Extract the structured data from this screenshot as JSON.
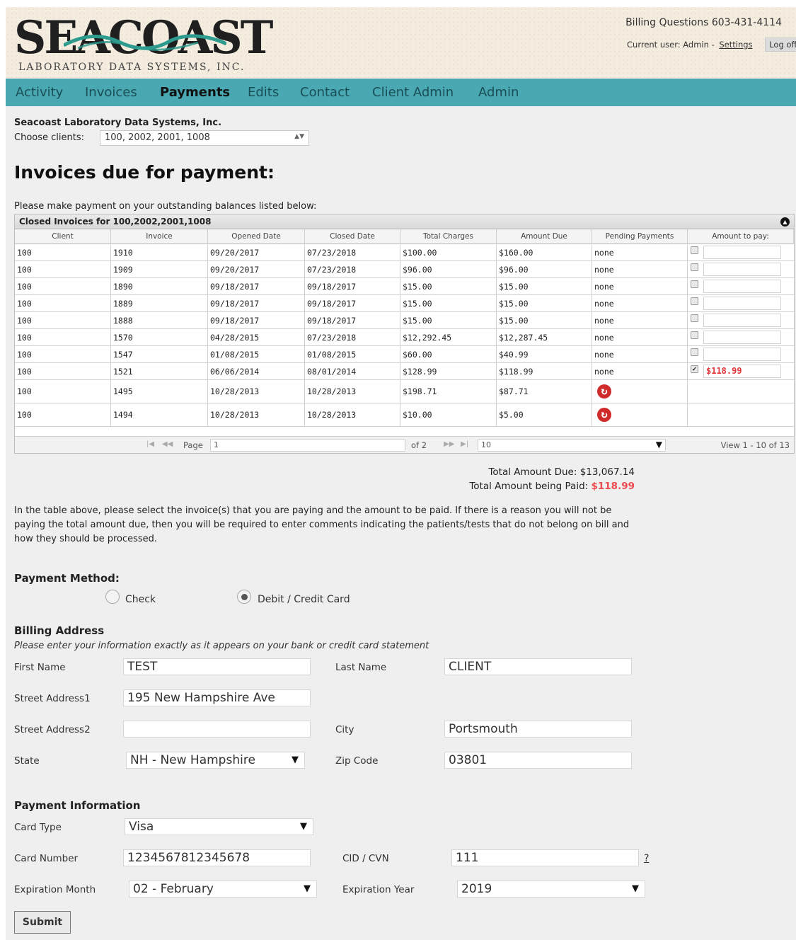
{
  "header": {
    "logo_main": "SEACOAST",
    "logo_sub": "LABORATORY DATA SYSTEMS, INC.",
    "billing_questions": "Billing Questions 603-431-4114",
    "current_user": "Current user: Admin -",
    "settings_label": "Settings",
    "logoff_label": "Log off"
  },
  "nav": [
    "Activity",
    "Invoices",
    "Payments",
    "Edits",
    "Contact",
    "Client Admin",
    "Admin"
  ],
  "nav_active": "Payments",
  "clients": {
    "org_name": "Seacoast Laboratory Data Systems, Inc.",
    "choose_label": "Choose clients:",
    "selected": "100, 2002, 2001, 1008"
  },
  "page_title": "Invoices due for payment:",
  "instructions": "Please make payment on your outstanding balances listed below:",
  "grid": {
    "caption": "Closed Invoices for 100,2002,2001,1008",
    "columns": [
      "Client",
      "Invoice",
      "Opened Date",
      "Closed Date",
      "Total Charges",
      "Amount Due",
      "Pending Payments",
      "Amount to pay:"
    ],
    "rows": [
      {
        "client": "100",
        "invoice": "1910",
        "opened": "09/20/2017",
        "closed": "07/23/2018",
        "total": "$100.00",
        "due": "$160.00",
        "pending": "none",
        "checked": false,
        "pay": ""
      },
      {
        "client": "100",
        "invoice": "1909",
        "opened": "09/20/2017",
        "closed": "07/23/2018",
        "total": "$96.00",
        "due": "$96.00",
        "pending": "none",
        "checked": false,
        "pay": ""
      },
      {
        "client": "100",
        "invoice": "1890",
        "opened": "09/18/2017",
        "closed": "09/18/2017",
        "total": "$15.00",
        "due": "$15.00",
        "pending": "none",
        "checked": false,
        "pay": ""
      },
      {
        "client": "100",
        "invoice": "1889",
        "opened": "09/18/2017",
        "closed": "09/18/2017",
        "total": "$15.00",
        "due": "$15.00",
        "pending": "none",
        "checked": false,
        "pay": ""
      },
      {
        "client": "100",
        "invoice": "1888",
        "opened": "09/18/2017",
        "closed": "09/18/2017",
        "total": "$15.00",
        "due": "$15.00",
        "pending": "none",
        "checked": false,
        "pay": ""
      },
      {
        "client": "100",
        "invoice": "1570",
        "opened": "04/28/2015",
        "closed": "07/23/2018",
        "total": "$12,292.45",
        "due": "$12,287.45",
        "pending": "none",
        "checked": false,
        "pay": ""
      },
      {
        "client": "100",
        "invoice": "1547",
        "opened": "01/08/2015",
        "closed": "01/08/2015",
        "total": "$60.00",
        "due": "$40.99",
        "pending": "none",
        "checked": false,
        "pay": ""
      },
      {
        "client": "100",
        "invoice": "1521",
        "opened": "06/06/2014",
        "closed": "08/01/2014",
        "total": "$128.99",
        "due": "$118.99",
        "pending": "none",
        "checked": true,
        "pay": "$118.99"
      },
      {
        "client": "100",
        "invoice": "1495",
        "opened": "10/28/2013",
        "closed": "10/28/2013",
        "total": "$198.71",
        "due": "$87.71",
        "pending": "refresh-icon",
        "checked": null,
        "pay": ""
      },
      {
        "client": "100",
        "invoice": "1494",
        "opened": "10/28/2013",
        "closed": "10/28/2013",
        "total": "$10.00",
        "due": "$5.00",
        "pending": "refresh-icon",
        "checked": null,
        "pay": ""
      }
    ],
    "pager": {
      "page_label": "Page",
      "page_value": "1",
      "of_label": "of 2",
      "rows_value": "10",
      "view_label": "View 1 - 10 of 13"
    }
  },
  "totals": {
    "due_label": "Total Amount Due:",
    "due_value": "$13,067.14",
    "paid_label": "Total Amount being Paid:",
    "paid_value": "$118.99"
  },
  "note": "In the table above, please select the invoice(s) that you are paying and the amount to be paid. If there is a reason you will not be paying the total amount due, then you will be required to enter comments indicating the patients/tests that do not belong on bill and how they should be processed.",
  "payment_method": {
    "title": "Payment Method:",
    "options": [
      "Check",
      "Debit / Credit Card"
    ],
    "selected": "Debit / Credit Card"
  },
  "billing": {
    "title": "Billing Address",
    "subnote": "Please enter your information exactly as it appears on your bank or credit card statement",
    "first_name_label": "First Name",
    "first_name": "TEST",
    "last_name_label": "Last Name",
    "last_name": "CLIENT",
    "street1_label": "Street Address1",
    "street1": "195 New Hampshire Ave",
    "street2_label": "Street Address2",
    "street2": "",
    "city_label": "City",
    "city": "Portsmouth",
    "state_label": "State",
    "state": "NH - New Hampshire",
    "zip_label": "Zip Code",
    "zip": "03801"
  },
  "payment_info": {
    "title": "Payment Information",
    "card_type_label": "Card Type",
    "card_type": "Visa",
    "card_number_label": "Card Number",
    "card_number": "1234567812345678",
    "cvn_label": "CID / CVN",
    "cvn": "111",
    "cvn_help": "?",
    "exp_month_label": "Expiration Month",
    "exp_month": "02 - February",
    "exp_year_label": "Expiration Year",
    "exp_year": "2019"
  },
  "submit_label": "Submit",
  "colors": {
    "nav_bg": "#4aa8b3",
    "accent_red": "#ee4a50",
    "page_bg": "#efefef"
  }
}
